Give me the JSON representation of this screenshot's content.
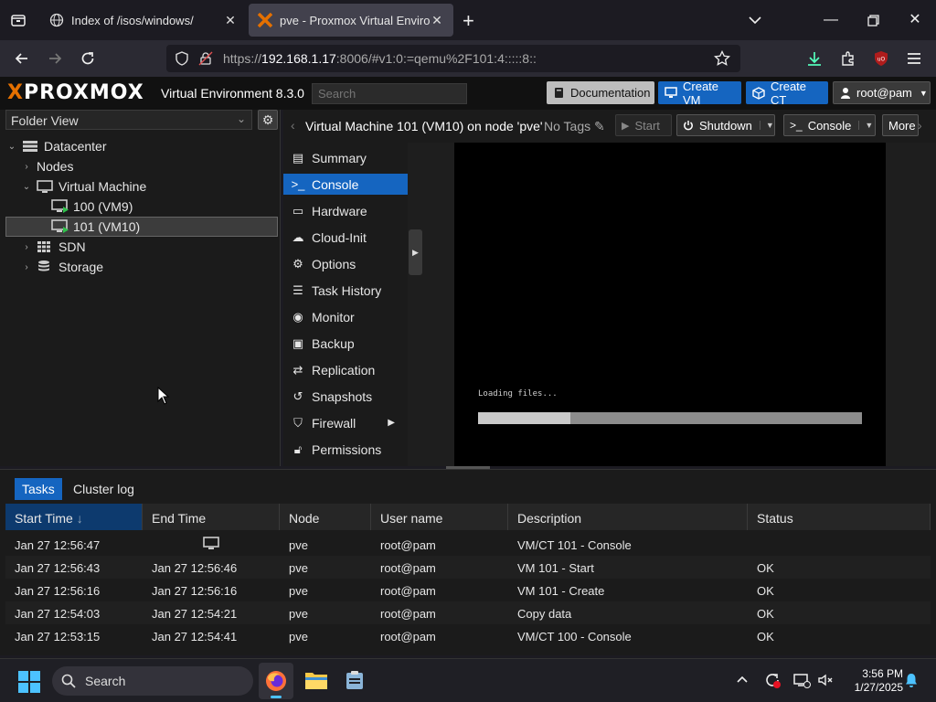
{
  "browser": {
    "tabs": [
      {
        "title": "Index of /isos/windows/",
        "active": false
      },
      {
        "title": "pve - Proxmox Virtual Environme",
        "active": true
      }
    ],
    "new_tab": "+",
    "url_prefix": "https://",
    "url_host": "192.168.1.17",
    "url_rest": ":8006/#v1:0:=qemu%2F101:4:::::8::"
  },
  "pve": {
    "logo_part1": "X",
    "logo_part2": "PROXMOX",
    "version": "Virtual Environment 8.3.0",
    "search_placeholder": "Search",
    "documentation": "Documentation",
    "create_vm": "Create VM",
    "create_ct": "Create CT",
    "user": "root@pam"
  },
  "tree": {
    "view": "Folder View",
    "items": [
      {
        "label": "Datacenter"
      },
      {
        "label": "Nodes"
      },
      {
        "label": "Virtual Machine"
      },
      {
        "label": "100 (VM9)"
      },
      {
        "label": "101 (VM10)"
      },
      {
        "label": "SDN"
      },
      {
        "label": "Storage"
      }
    ]
  },
  "vmbar": {
    "title": "Virtual Machine 101 (VM10) on node 'pve'",
    "tags": "No Tags",
    "start": "Start",
    "shutdown": "Shutdown",
    "console": "Console",
    "more": "More"
  },
  "menu": {
    "items": [
      {
        "label": "Summary"
      },
      {
        "label": "Console"
      },
      {
        "label": "Hardware"
      },
      {
        "label": "Cloud-Init"
      },
      {
        "label": "Options"
      },
      {
        "label": "Task History"
      },
      {
        "label": "Monitor"
      },
      {
        "label": "Backup"
      },
      {
        "label": "Replication"
      },
      {
        "label": "Snapshots"
      },
      {
        "label": "Firewall"
      },
      {
        "label": "Permissions"
      }
    ]
  },
  "console": {
    "text": "Loading files...",
    "progress": 0.24
  },
  "tasks": {
    "tab_tasks": "Tasks",
    "tab_log": "Cluster log",
    "columns": [
      "Start Time",
      "End Time",
      "Node",
      "User name",
      "Description",
      "Status"
    ],
    "sort_indicator": "↓",
    "rows": [
      [
        "Jan 27 12:56:47",
        "",
        "pve",
        "root@pam",
        "VM/CT 101 - Console",
        ""
      ],
      [
        "Jan 27 12:56:43",
        "Jan 27 12:56:46",
        "pve",
        "root@pam",
        "VM 101 - Start",
        "OK"
      ],
      [
        "Jan 27 12:56:16",
        "Jan 27 12:56:16",
        "pve",
        "root@pam",
        "VM 101 - Create",
        "OK"
      ],
      [
        "Jan 27 12:54:03",
        "Jan 27 12:54:21",
        "pve",
        "root@pam",
        "Copy data",
        "OK"
      ],
      [
        "Jan 27 12:53:15",
        "Jan 27 12:54:41",
        "pve",
        "root@pam",
        "VM/CT 100 - Console",
        "OK"
      ]
    ]
  },
  "taskbar": {
    "search": "Search",
    "time": "3:56 PM",
    "date": "1/27/2025"
  },
  "colors": {
    "accent": "#1565c0",
    "proxmox_orange": "#e57000"
  }
}
